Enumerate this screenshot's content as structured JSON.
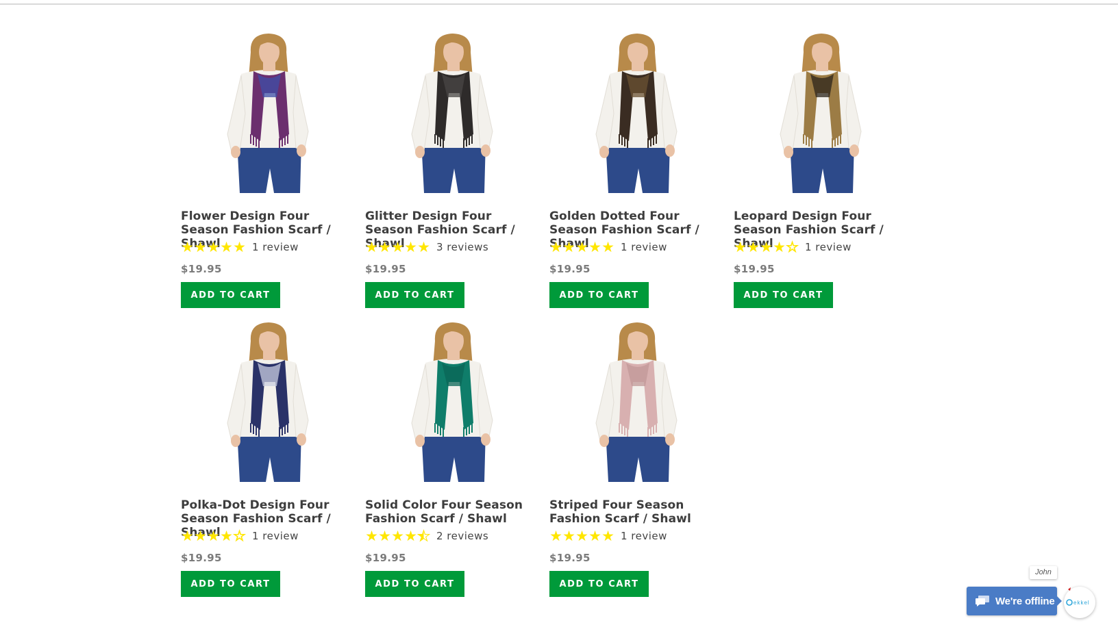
{
  "products": [
    {
      "title": "Flower Design Four Season Fashion Scarf / Shawl",
      "rating": 5,
      "reviews": "1 review",
      "price": "$19.95",
      "button": "ADD TO CART",
      "scarf_color": "#6b2f6e",
      "scarf_accent": "#3d4fa8"
    },
    {
      "title": "Glitter Design Four Season Fashion Scarf / Shawl",
      "rating": 5,
      "reviews": "3 reviews",
      "price": "$19.95",
      "button": "ADD TO CART",
      "scarf_color": "#2e2b2a",
      "scarf_accent": "#4a4745"
    },
    {
      "title": "Golden Dotted Four Season Fashion Scarf / Shawl",
      "rating": 5,
      "reviews": "1 review",
      "price": "$19.95",
      "button": "ADD TO CART",
      "scarf_color": "#3a2c22",
      "scarf_accent": "#6b5233"
    },
    {
      "title": "Leopard Design Four Season Fashion Scarf / Shawl",
      "rating": 4,
      "reviews": "1 review",
      "price": "$19.95",
      "button": "ADD TO CART",
      "scarf_color": "#9c7c45",
      "scarf_accent": "#2c241b"
    },
    {
      "title": "Polka-Dot Design Four Season Fashion Scarf / Shawl",
      "rating": 4,
      "reviews": "1 review",
      "price": "$19.95",
      "button": "ADD TO CART",
      "scarf_color": "#2a3268",
      "scarf_accent": "#c9cde0"
    },
    {
      "title": "Solid Color Four Season Fashion Scarf / Shawl",
      "rating": 4.5,
      "reviews": "2 reviews",
      "price": "$19.95",
      "button": "ADD TO CART",
      "scarf_color": "#0f7d6a",
      "scarf_accent": "#0b6657"
    },
    {
      "title": "Striped Four Season Fashion Scarf / Shawl",
      "rating": 5,
      "reviews": "1 review",
      "price": "$19.95",
      "button": "ADD TO CART",
      "scarf_color": "#d8b0b0",
      "scarf_accent": "#c19898"
    }
  ],
  "chat": {
    "label": "We're offline",
    "agent": "John",
    "color": "#4a7cc6"
  },
  "colors": {
    "button": "#009a3a",
    "star": "#ffe600",
    "denim": "#2d4a8a",
    "sweater": "#f3f1ec",
    "hair": "#b88a4a",
    "skin": "#e9c2a6"
  }
}
